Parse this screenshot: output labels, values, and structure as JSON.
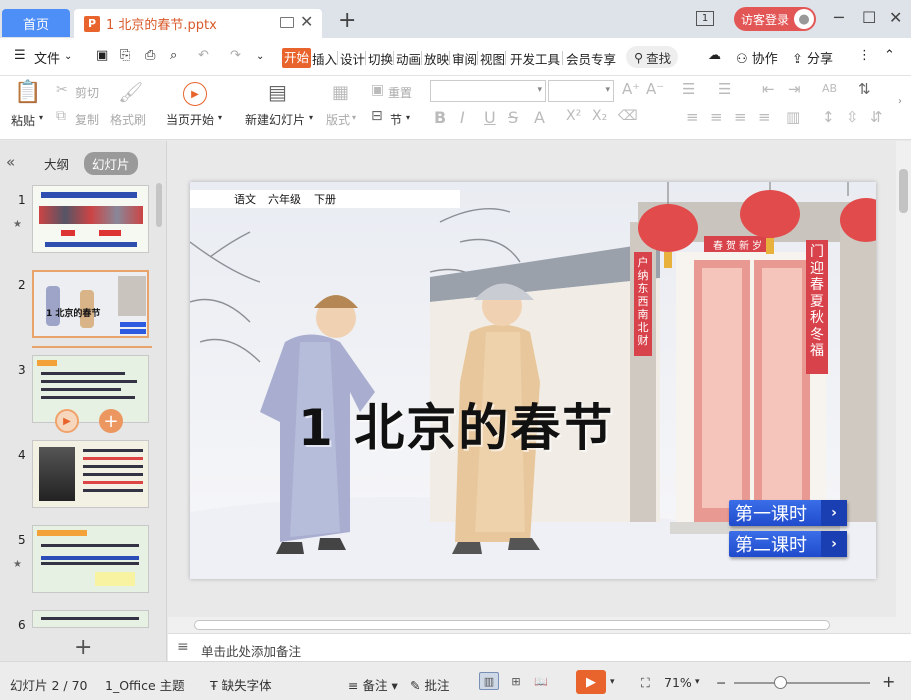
{
  "titlebar": {
    "home_tab": "首页",
    "doc_tab_badge": "P",
    "doc_tab_title": "1 北京的春节.pptx",
    "window_count": "1",
    "login_label": "访客登录"
  },
  "menubar": {
    "file_menu": "文件",
    "tabs": [
      "开始",
      "插入",
      "设计",
      "切换",
      "动画",
      "放映",
      "审阅",
      "视图",
      "开发工具",
      "会员专享"
    ],
    "search": "查找",
    "collab": "协作",
    "share": "分享"
  },
  "ribbon": {
    "paste": "粘贴",
    "cut": "剪切",
    "copy": "复制",
    "format_painter": "格式刷",
    "start_from_current": "当页开始",
    "new_slide": "新建幻灯片",
    "layout": "版式",
    "section": "节",
    "reset": "重置",
    "font_name": "",
    "font_size": ""
  },
  "left_panel": {
    "outline_tab": "大纲",
    "slides_tab": "幻灯片",
    "thumb_numbers": [
      "1",
      "2",
      "3",
      "4",
      "5",
      "6"
    ],
    "thumb2_title": "1  北京的春节"
  },
  "slide": {
    "meta": [
      "语文",
      "六年级",
      "下册"
    ],
    "title": "1    北京的春节",
    "couplet_left": "户纳东西南北财",
    "couplet_right": "门迎春夏秋冬福",
    "banner": "春贺新岁",
    "buttons": [
      "第一课时",
      "第二课时"
    ]
  },
  "notes": {
    "placeholder": "单击此处添加备注"
  },
  "statusbar": {
    "slide_counter": "幻灯片 2 / 70",
    "theme": "1_Office 主题",
    "missing_font": "缺失字体",
    "notes": "备注",
    "comments": "批注",
    "zoom": "71%"
  }
}
